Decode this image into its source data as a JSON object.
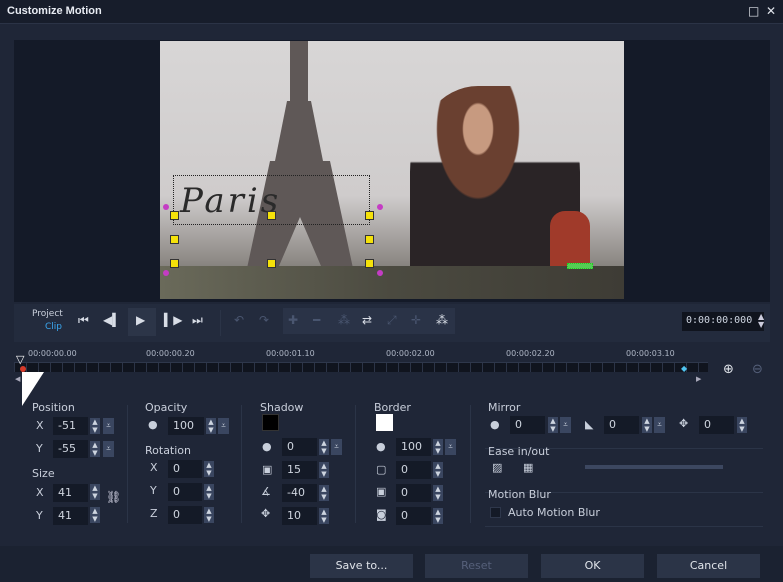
{
  "window": {
    "title": "Customize Motion",
    "maximize_icon": "□",
    "close_icon": "✕"
  },
  "preview": {
    "overlay_text": "Paris"
  },
  "transport": {
    "project_label": "Project",
    "clip_label": "Clip",
    "timecode": "0:00:00:000"
  },
  "timeline": {
    "ticks": [
      "00:00:00.00",
      "00:00:00.20",
      "00:00:01.10",
      "00:00:02.00",
      "00:00:02.20",
      "00:00:03.10"
    ]
  },
  "position": {
    "title": "Position",
    "x_label": "X",
    "x": "-51",
    "y_label": "Y",
    "y": "-55"
  },
  "size": {
    "title": "Size",
    "x_label": "X",
    "x": "41",
    "y_label": "Y",
    "y": "41"
  },
  "opacity": {
    "title": "Opacity",
    "value": "100"
  },
  "rotation": {
    "title": "Rotation",
    "x_label": "X",
    "x": "0",
    "y_label": "Y",
    "y": "0",
    "z_label": "Z",
    "z": "0"
  },
  "shadow": {
    "title": "Shadow",
    "color": "#000000",
    "opacity": "0",
    "blur": "15",
    "angle": "-40",
    "distance": "10"
  },
  "border": {
    "title": "Border",
    "color": "#ffffff",
    "opacity": "100",
    "width": "0",
    "blur": "0",
    "corner": "0"
  },
  "mirror": {
    "title": "Mirror",
    "opacity": "0",
    "fade": "0",
    "offset": "0"
  },
  "ease": {
    "title": "Ease in/out"
  },
  "motion_blur": {
    "title": "Motion Blur",
    "auto_label": "Auto Motion Blur",
    "checked": false
  },
  "buttons": {
    "save_to": "Save to...",
    "reset": "Reset",
    "ok": "OK",
    "cancel": "Cancel"
  }
}
